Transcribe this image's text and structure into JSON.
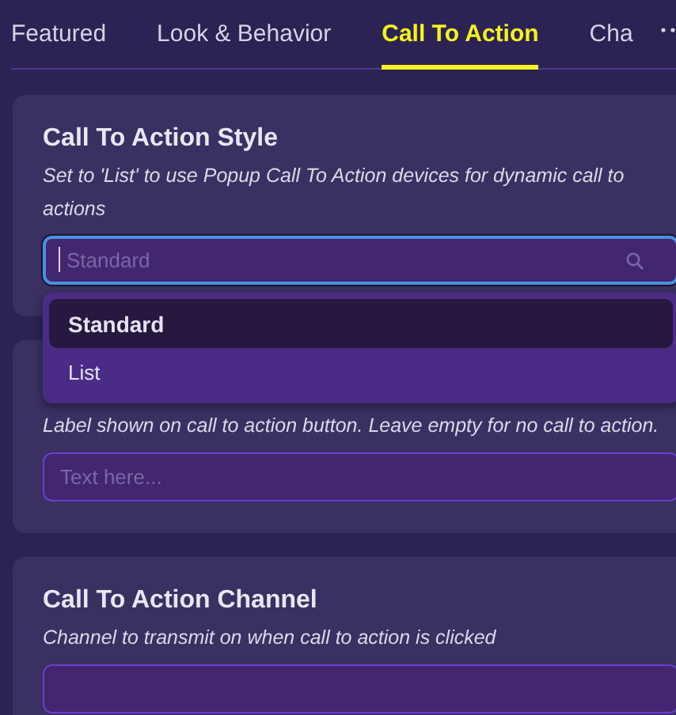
{
  "tabs": [
    {
      "label": "Featured",
      "selected": false
    },
    {
      "label": "Look & Behavior",
      "selected": false
    },
    {
      "label": "Call To Action",
      "selected": true
    },
    {
      "label": "Cha",
      "selected": false
    }
  ],
  "cards": [
    {
      "title": "Call To Action Style",
      "description": "Set to 'List' to use Popup Call To Action devices for dynamic call to actions",
      "field": {
        "kind": "search",
        "placeholder": "Standard",
        "focused": true
      },
      "dropdown": {
        "options": [
          {
            "label": "Standard",
            "selected": true
          },
          {
            "label": "List",
            "selected": false
          }
        ]
      }
    },
    {
      "description": "Label shown on call to action button. Leave empty for no call to action.",
      "field": {
        "kind": "text",
        "placeholder": "Text here...",
        "focused": false
      }
    },
    {
      "title": "Call To Action Channel",
      "description": "Channel to transmit on when call to action is clicked",
      "field": {
        "kind": "text",
        "focused": false
      }
    }
  ]
}
